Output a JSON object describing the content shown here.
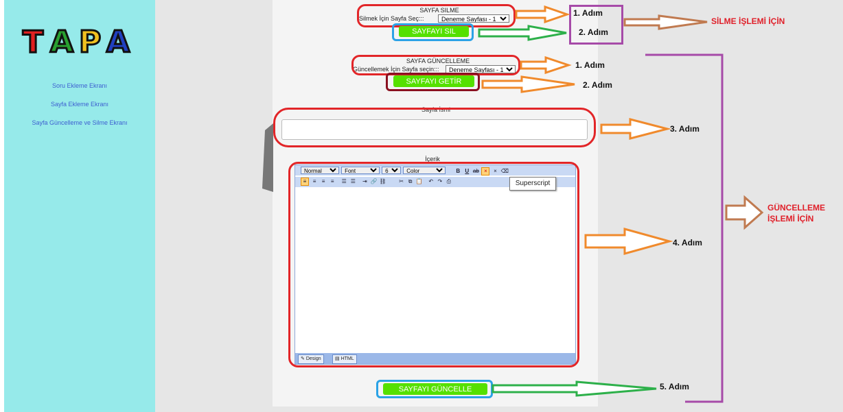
{
  "sidebar": {
    "logo_text": "TAPA",
    "items": [
      {
        "label": "Soru Ekleme Ekranı"
      },
      {
        "label": "Sayfa Ekleme Ekranı"
      },
      {
        "label": "Sayfa Güncelleme ve Silme Ekranı"
      }
    ]
  },
  "delete_section": {
    "title": "SAYFA SILME",
    "select_label": "Silmek İçin Sayfa Seç:::",
    "select_value": "Deneme Sayfası - 1",
    "button_label": "SAYFAYI SIL"
  },
  "update_section": {
    "title": "SAYFA GÜNCELLEME",
    "select_label": "Güncellemek İçin Sayfa seçin:::",
    "select_value": "Deneme Sayfası - 1",
    "button_label": "SAYFAYI GETİR"
  },
  "page_name": {
    "label": "Sayfa İsmi",
    "value": ""
  },
  "content": {
    "label": "İçerik",
    "toolbar": {
      "format_value": "Normal",
      "font_value": "Font",
      "size_value": "6",
      "color_value": "Color"
    },
    "tooltip": "Superscript",
    "tab_design": "Design",
    "tab_html": "HTML"
  },
  "update_button_label": "SAYFAYI GÜNCELLE",
  "annotations": {
    "step1_top": "1. Adım",
    "step2_top": "2. Adım",
    "delete_note": "SİLME İŞLEMİ İÇİN",
    "step1_mid": "1. Adım",
    "step2_mid": "2. Adım",
    "step3": "3. Adım",
    "step4": "4. Adım",
    "step5": "5. Adım",
    "update_note_line1": "GÜNCELLEME",
    "update_note_line2": "İŞLEMİ İÇİN"
  },
  "colors": {
    "sidebar_bg": "#96eaea",
    "button_green": "#55e000",
    "box_red": "#e22528",
    "box_blue": "#2ba2e6",
    "box_purple": "#a64aa8",
    "arrow_orange": "#f08a2c",
    "arrow_green": "#2db04a",
    "arrow_brown": "#c07a50"
  }
}
